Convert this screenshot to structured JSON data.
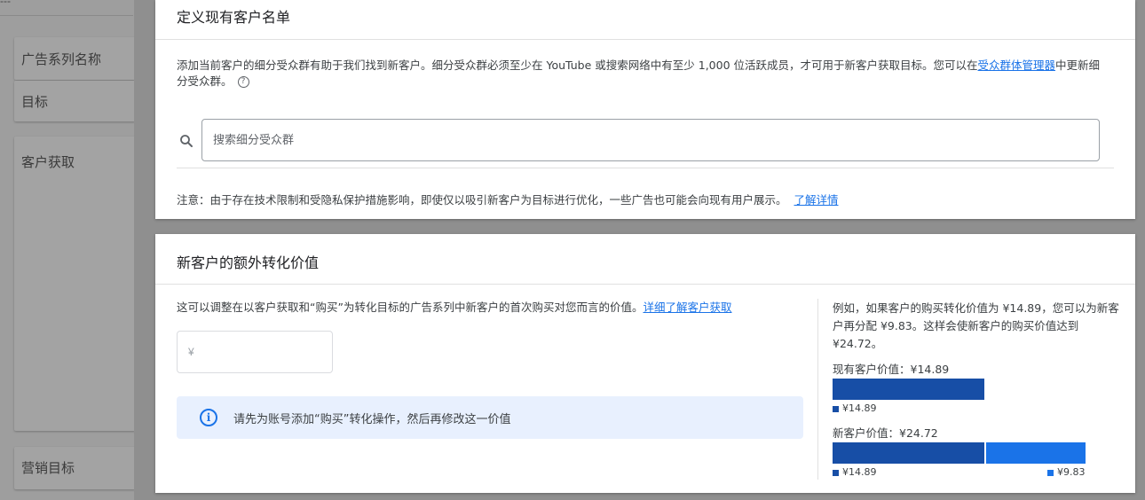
{
  "background": {
    "top_text": "---",
    "items": [
      {
        "label": "广告系列名称"
      },
      {
        "label": "目标"
      },
      {
        "label": "客户获取"
      },
      {
        "label": "营销目标"
      }
    ]
  },
  "customer_list": {
    "title": "定义现有客户名单",
    "description_part1": "添加当前客户的细分受众群有助于我们找到新客户。细分受众群必须至少在 YouTube 或搜索网络中有至少 1,000 位活跃成员，才可用于新客户获取目标。您可以在",
    "description_link": "受众群体管理器",
    "description_part2": "中更新细分受众群。",
    "help_icon": "?",
    "search_placeholder": "搜索细分受众群",
    "note_text": "注意：由于存在技术限制和受隐私保护措施影响，即使仅以吸引新客户为目标进行优化，一些广告也可能会向现有用户展示。",
    "note_link": "了解详情"
  },
  "conversion_value": {
    "title": "新客户的额外转化价值",
    "description": "这可以调整在以客户获取和“购买”为转化目标的广告系列中新客户的首次购买对您而言的价值。",
    "description_link": "详细了解客户获取",
    "currency_symbol": "¥",
    "info_icon": "i",
    "info_text": "请先为账号添加“购买”转化操作，然后再修改这一价值",
    "example_text": "例如，如果客户的购买转化价值为 ¥14.89，您可以为新客户再分配 ¥9.83。这样会使新客户的购买价值达到 ¥24.72。",
    "existing_label": "现有客户价值：¥14.89",
    "existing_legend": "¥14.89",
    "new_label": "新客户价值：¥24.72",
    "new_legend_base": "¥14.89",
    "new_legend_extra": "¥9.83",
    "colors": {
      "base": "#174ea6",
      "extra": "#1a73e8"
    }
  }
}
